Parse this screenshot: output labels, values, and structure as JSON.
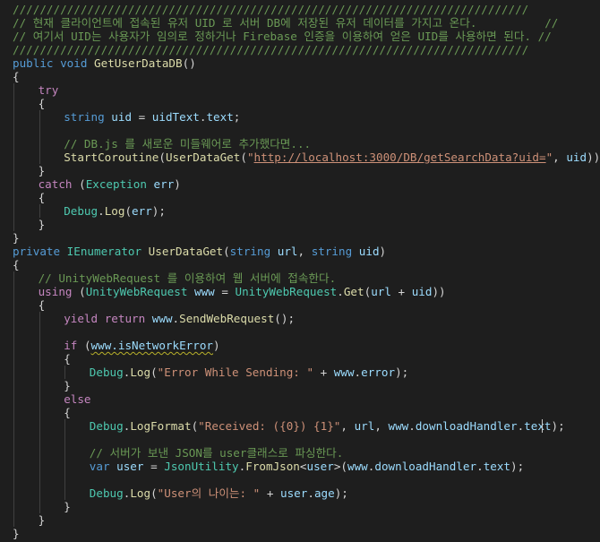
{
  "editor": {
    "name": "code-editor",
    "colors": {
      "background": "#1e1e1e",
      "comment": "#6a9955",
      "keyword": "#569cd6",
      "control": "#c586c0",
      "type": "#4ec9b0",
      "function": "#dcdcaa",
      "variable": "#9cdcfe",
      "string": "#ce9178",
      "plain": "#d4d4d4",
      "warning_squiggle": "#b8b02a"
    },
    "lines": [
      {
        "indent": 0,
        "tokens": [
          {
            "t": "cm",
            "v": "////////////////////////////////////////////////////////////////////////////"
          }
        ]
      },
      {
        "indent": 0,
        "tokens": [
          {
            "t": "cm",
            "v": "// 현재 클라이언트에 접속된 유저 UID 로 서버 DB에 저장된 유저 데이터를 가지고 온다.          //"
          }
        ]
      },
      {
        "indent": 0,
        "tokens": [
          {
            "t": "cm",
            "v": "// 여기서 UID는 사용자가 임의로 정하거나 Firebase 인증을 이용하여 얻은 UID를 사용하면 된다. //"
          }
        ]
      },
      {
        "indent": 0,
        "tokens": [
          {
            "t": "cm",
            "v": "////////////////////////////////////////////////////////////////////////////"
          }
        ]
      },
      {
        "indent": 0,
        "tokens": [
          {
            "t": "kw",
            "v": "public"
          },
          {
            "t": "p",
            "v": " "
          },
          {
            "t": "kw",
            "v": "void"
          },
          {
            "t": "p",
            "v": " "
          },
          {
            "t": "fn",
            "v": "GetUserDataDB"
          },
          {
            "t": "p",
            "v": "()"
          }
        ]
      },
      {
        "indent": 0,
        "tokens": [
          {
            "t": "p",
            "v": "{"
          }
        ]
      },
      {
        "indent": 1,
        "tokens": [
          {
            "t": "ctl",
            "v": "try"
          }
        ]
      },
      {
        "indent": 1,
        "tokens": [
          {
            "t": "p",
            "v": "{"
          }
        ]
      },
      {
        "indent": 2,
        "tokens": [
          {
            "t": "kw",
            "v": "string"
          },
          {
            "t": "p",
            "v": " "
          },
          {
            "t": "var",
            "v": "uid"
          },
          {
            "t": "p",
            "v": " = "
          },
          {
            "t": "var",
            "v": "uidText"
          },
          {
            "t": "p",
            "v": "."
          },
          {
            "t": "var",
            "v": "text"
          },
          {
            "t": "p",
            "v": ";"
          }
        ]
      },
      {
        "indent": 0,
        "tokens": []
      },
      {
        "indent": 2,
        "tokens": [
          {
            "t": "cm",
            "v": "// DB.js 를 새로운 미들웨어로 추가했다면..."
          }
        ]
      },
      {
        "indent": 2,
        "tokens": [
          {
            "t": "fn",
            "v": "StartCoroutine"
          },
          {
            "t": "p",
            "v": "("
          },
          {
            "t": "fn",
            "v": "UserDataGet"
          },
          {
            "t": "p",
            "v": "("
          },
          {
            "t": "str",
            "v": "\""
          },
          {
            "t": "url",
            "v": "http://localhost:3000/DB/getSearchData?uid="
          },
          {
            "t": "str",
            "v": "\""
          },
          {
            "t": "p",
            "v": ", "
          },
          {
            "t": "var",
            "v": "uid"
          },
          {
            "t": "p",
            "v": "));"
          }
        ]
      },
      {
        "indent": 1,
        "tokens": [
          {
            "t": "p",
            "v": "}"
          }
        ]
      },
      {
        "indent": 1,
        "tokens": [
          {
            "t": "ctl",
            "v": "catch"
          },
          {
            "t": "p",
            "v": " ("
          },
          {
            "t": "ty",
            "v": "Exception"
          },
          {
            "t": "p",
            "v": " "
          },
          {
            "t": "var",
            "v": "err"
          },
          {
            "t": "p",
            "v": ")"
          }
        ]
      },
      {
        "indent": 1,
        "tokens": [
          {
            "t": "p",
            "v": "{"
          }
        ]
      },
      {
        "indent": 2,
        "tokens": [
          {
            "t": "ty",
            "v": "Debug"
          },
          {
            "t": "p",
            "v": "."
          },
          {
            "t": "fn",
            "v": "Log"
          },
          {
            "t": "p",
            "v": "("
          },
          {
            "t": "var",
            "v": "err"
          },
          {
            "t": "p",
            "v": ");"
          }
        ]
      },
      {
        "indent": 1,
        "tokens": [
          {
            "t": "p",
            "v": "}"
          }
        ]
      },
      {
        "indent": 0,
        "tokens": [
          {
            "t": "p",
            "v": "}"
          }
        ]
      },
      {
        "indent": 0,
        "tokens": [
          {
            "t": "kw",
            "v": "private"
          },
          {
            "t": "p",
            "v": " "
          },
          {
            "t": "ty",
            "v": "IEnumerator"
          },
          {
            "t": "p",
            "v": " "
          },
          {
            "t": "fn",
            "v": "UserDataGet"
          },
          {
            "t": "p",
            "v": "("
          },
          {
            "t": "kw",
            "v": "string"
          },
          {
            "t": "p",
            "v": " "
          },
          {
            "t": "var",
            "v": "url"
          },
          {
            "t": "p",
            "v": ", "
          },
          {
            "t": "kw",
            "v": "string"
          },
          {
            "t": "p",
            "v": " "
          },
          {
            "t": "var",
            "v": "uid"
          },
          {
            "t": "p",
            "v": ")"
          }
        ]
      },
      {
        "indent": 0,
        "tokens": [
          {
            "t": "p",
            "v": "{"
          }
        ]
      },
      {
        "indent": 1,
        "tokens": [
          {
            "t": "cm",
            "v": "// UnityWebRequest 를 이용하여 웹 서버에 접속한다."
          }
        ]
      },
      {
        "indent": 1,
        "tokens": [
          {
            "t": "ctl",
            "v": "using"
          },
          {
            "t": "p",
            "v": " ("
          },
          {
            "t": "ty",
            "v": "UnityWebRequest"
          },
          {
            "t": "p",
            "v": " "
          },
          {
            "t": "var",
            "v": "www"
          },
          {
            "t": "p",
            "v": " = "
          },
          {
            "t": "ty",
            "v": "UnityWebRequest"
          },
          {
            "t": "p",
            "v": "."
          },
          {
            "t": "fn",
            "v": "Get"
          },
          {
            "t": "p",
            "v": "("
          },
          {
            "t": "var",
            "v": "url"
          },
          {
            "t": "p",
            "v": " + "
          },
          {
            "t": "var",
            "v": "uid"
          },
          {
            "t": "p",
            "v": "))"
          }
        ]
      },
      {
        "indent": 1,
        "tokens": [
          {
            "t": "p",
            "v": "{"
          }
        ]
      },
      {
        "indent": 2,
        "tokens": [
          {
            "t": "ctl",
            "v": "yield"
          },
          {
            "t": "p",
            "v": " "
          },
          {
            "t": "ctl",
            "v": "return"
          },
          {
            "t": "p",
            "v": " "
          },
          {
            "t": "var",
            "v": "www"
          },
          {
            "t": "p",
            "v": "."
          },
          {
            "t": "fn",
            "v": "SendWebRequest"
          },
          {
            "t": "p",
            "v": "();"
          }
        ]
      },
      {
        "indent": 0,
        "tokens": []
      },
      {
        "indent": 2,
        "tokens": [
          {
            "t": "ctl",
            "v": "if"
          },
          {
            "t": "p",
            "v": " ("
          },
          {
            "t": "warn",
            "v": "www.isNetworkError"
          },
          {
            "t": "p",
            "v": ")"
          }
        ]
      },
      {
        "indent": 2,
        "tokens": [
          {
            "t": "p",
            "v": "{"
          }
        ]
      },
      {
        "indent": 3,
        "tokens": [
          {
            "t": "ty",
            "v": "Debug"
          },
          {
            "t": "p",
            "v": "."
          },
          {
            "t": "fn",
            "v": "Log"
          },
          {
            "t": "p",
            "v": "("
          },
          {
            "t": "str",
            "v": "\"Error While Sending: \""
          },
          {
            "t": "p",
            "v": " + "
          },
          {
            "t": "var",
            "v": "www"
          },
          {
            "t": "p",
            "v": "."
          },
          {
            "t": "var",
            "v": "error"
          },
          {
            "t": "p",
            "v": ");"
          }
        ]
      },
      {
        "indent": 2,
        "tokens": [
          {
            "t": "p",
            "v": "}"
          }
        ]
      },
      {
        "indent": 2,
        "tokens": [
          {
            "t": "ctl",
            "v": "else"
          }
        ]
      },
      {
        "indent": 2,
        "tokens": [
          {
            "t": "p",
            "v": "{"
          }
        ]
      },
      {
        "indent": 3,
        "tokens": [
          {
            "t": "ty",
            "v": "Debug"
          },
          {
            "t": "p",
            "v": "."
          },
          {
            "t": "fn",
            "v": "LogFormat"
          },
          {
            "t": "p",
            "v": "("
          },
          {
            "t": "str",
            "v": "\"Received: ({0}) {1}\""
          },
          {
            "t": "p",
            "v": ", "
          },
          {
            "t": "var",
            "v": "url"
          },
          {
            "t": "p",
            "v": ", "
          },
          {
            "t": "var",
            "v": "www"
          },
          {
            "t": "p",
            "v": "."
          },
          {
            "t": "var",
            "v": "downloadHandler"
          },
          {
            "t": "p",
            "v": "."
          },
          {
            "t": "var",
            "v": "text"
          },
          {
            "t": "p",
            "v": ");"
          }
        ]
      },
      {
        "indent": 0,
        "tokens": []
      },
      {
        "indent": 3,
        "tokens": [
          {
            "t": "cm",
            "v": "// 서버가 보낸 JSON를 user클래스로 파싱한다."
          }
        ]
      },
      {
        "indent": 3,
        "tokens": [
          {
            "t": "kw",
            "v": "var"
          },
          {
            "t": "p",
            "v": " "
          },
          {
            "t": "var",
            "v": "user"
          },
          {
            "t": "p",
            "v": " = "
          },
          {
            "t": "ty",
            "v": "JsonUtility"
          },
          {
            "t": "p",
            "v": "."
          },
          {
            "t": "fn",
            "v": "FromJson"
          },
          {
            "t": "p",
            "v": "<"
          },
          {
            "t": "var",
            "v": "user"
          },
          {
            "t": "p",
            "v": ">("
          },
          {
            "t": "var",
            "v": "www"
          },
          {
            "t": "p",
            "v": "."
          },
          {
            "t": "var",
            "v": "downloadHandler"
          },
          {
            "t": "p",
            "v": "."
          },
          {
            "t": "var",
            "v": "text"
          },
          {
            "t": "p",
            "v": ");"
          }
        ]
      },
      {
        "indent": 0,
        "tokens": []
      },
      {
        "indent": 3,
        "tokens": [
          {
            "t": "ty",
            "v": "Debug"
          },
          {
            "t": "p",
            "v": "."
          },
          {
            "t": "fn",
            "v": "Log"
          },
          {
            "t": "p",
            "v": "("
          },
          {
            "t": "str",
            "v": "\"User의 나이는: \""
          },
          {
            "t": "p",
            "v": " + "
          },
          {
            "t": "var",
            "v": "user"
          },
          {
            "t": "p",
            "v": "."
          },
          {
            "t": "var",
            "v": "age"
          },
          {
            "t": "p",
            "v": ");"
          }
        ]
      },
      {
        "indent": 2,
        "tokens": [
          {
            "t": "p",
            "v": "}"
          }
        ]
      },
      {
        "indent": 1,
        "tokens": [
          {
            "t": "p",
            "v": "}"
          }
        ]
      },
      {
        "indent": 0,
        "tokens": [
          {
            "t": "p",
            "v": "}"
          }
        ]
      }
    ]
  }
}
